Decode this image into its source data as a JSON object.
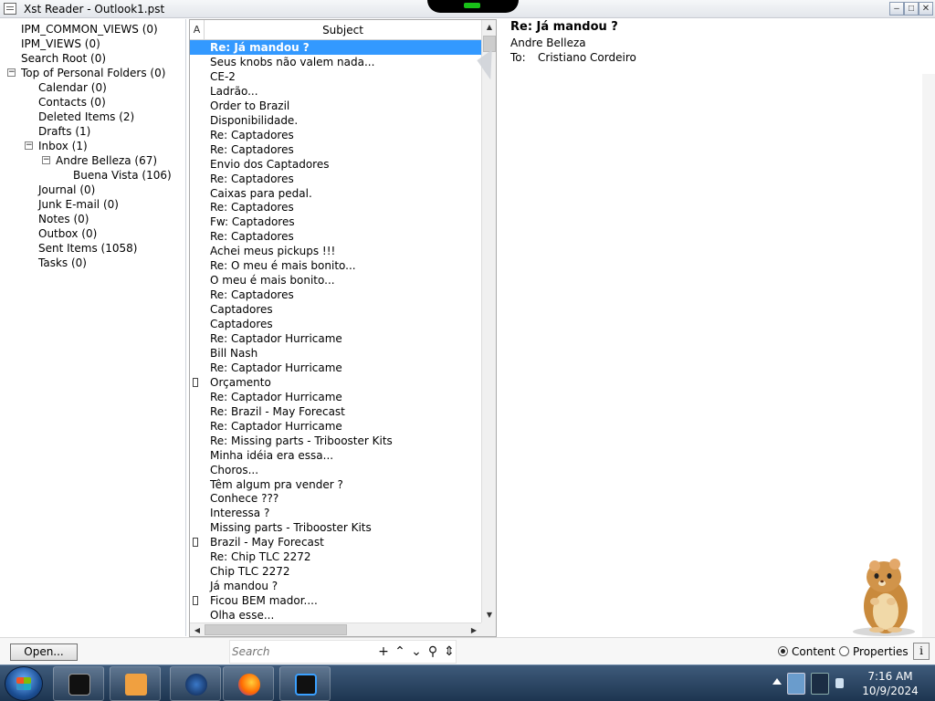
{
  "window": {
    "title": "Xst Reader - Outlook1.pst",
    "min_symbol": "–",
    "max_symbol": "□",
    "close_symbol": "✕"
  },
  "folders": [
    {
      "label": "IPM_COMMON_VIEWS (0)",
      "depth": 0,
      "expander": ""
    },
    {
      "label": "IPM_VIEWS (0)",
      "depth": 0,
      "expander": ""
    },
    {
      "label": "Search Root (0)",
      "depth": 0,
      "expander": ""
    },
    {
      "label": "Top of Personal Folders (0)",
      "depth": 0,
      "expander": "−"
    },
    {
      "label": "Calendar (0)",
      "depth": 1,
      "expander": ""
    },
    {
      "label": "Contacts (0)",
      "depth": 1,
      "expander": ""
    },
    {
      "label": "Deleted Items (2)",
      "depth": 1,
      "expander": ""
    },
    {
      "label": "Drafts (1)",
      "depth": 1,
      "expander": ""
    },
    {
      "label": "Inbox (1)",
      "depth": 1,
      "expander": "−"
    },
    {
      "label": "Andre Belleza (67)",
      "depth": 2,
      "expander": "−"
    },
    {
      "label": "Buena Vista (106)",
      "depth": 3,
      "expander": ""
    },
    {
      "label": "Journal (0)",
      "depth": 1,
      "expander": ""
    },
    {
      "label": "Junk E-mail (0)",
      "depth": 1,
      "expander": ""
    },
    {
      "label": "Notes (0)",
      "depth": 1,
      "expander": ""
    },
    {
      "label": "Outbox (0)",
      "depth": 1,
      "expander": ""
    },
    {
      "label": "Sent Items (1058)",
      "depth": 1,
      "expander": ""
    },
    {
      "label": "Tasks (0)",
      "depth": 1,
      "expander": ""
    }
  ],
  "list": {
    "attach_header": "A",
    "subject_header": "Subject",
    "up_arrow": "▲",
    "down_arrow": "▼",
    "left_arrow": "◀",
    "right_arrow": "▶"
  },
  "messages": [
    {
      "subject": "Re: Já mandou ?",
      "selected": true,
      "attachment": false
    },
    {
      "subject": "Seus knobs não valem nada...",
      "selected": false,
      "attachment": false
    },
    {
      "subject": "CE-2",
      "selected": false,
      "attachment": false
    },
    {
      "subject": "Ladrão...",
      "selected": false,
      "attachment": false
    },
    {
      "subject": "Order to Brazil",
      "selected": false,
      "attachment": false
    },
    {
      "subject": "Disponibilidade.",
      "selected": false,
      "attachment": false
    },
    {
      "subject": "Re: Captadores",
      "selected": false,
      "attachment": false
    },
    {
      "subject": "Re: Captadores",
      "selected": false,
      "attachment": false
    },
    {
      "subject": "Envio dos Captadores",
      "selected": false,
      "attachment": false
    },
    {
      "subject": "Re: Captadores",
      "selected": false,
      "attachment": false
    },
    {
      "subject": "Caixas para pedal.",
      "selected": false,
      "attachment": false
    },
    {
      "subject": "Re: Captadores",
      "selected": false,
      "attachment": false
    },
    {
      "subject": "Fw: Captadores",
      "selected": false,
      "attachment": false
    },
    {
      "subject": "Re: Captadores",
      "selected": false,
      "attachment": false
    },
    {
      "subject": "Achei meus pickups !!!",
      "selected": false,
      "attachment": false
    },
    {
      "subject": "Re: O meu é mais bonito...",
      "selected": false,
      "attachment": false
    },
    {
      "subject": "O meu é mais bonito...",
      "selected": false,
      "attachment": false
    },
    {
      "subject": "Re: Captadores",
      "selected": false,
      "attachment": false
    },
    {
      "subject": "Captadores",
      "selected": false,
      "attachment": false
    },
    {
      "subject": "Captadores",
      "selected": false,
      "attachment": false
    },
    {
      "subject": "Re: Captador Hurricame",
      "selected": false,
      "attachment": false
    },
    {
      "subject": "Bill Nash",
      "selected": false,
      "attachment": false
    },
    {
      "subject": "Re: Captador Hurricame",
      "selected": false,
      "attachment": false
    },
    {
      "subject": "Orçamento",
      "selected": false,
      "attachment": true
    },
    {
      "subject": "Re: Captador Hurricame",
      "selected": false,
      "attachment": false
    },
    {
      "subject": "Re: Brazil - May Forecast",
      "selected": false,
      "attachment": false
    },
    {
      "subject": "Re: Captador Hurricame",
      "selected": false,
      "attachment": false
    },
    {
      "subject": "Re: Missing parts - Tribooster Kits",
      "selected": false,
      "attachment": false
    },
    {
      "subject": "Minha idéia era essa...",
      "selected": false,
      "attachment": false
    },
    {
      "subject": "Choros...",
      "selected": false,
      "attachment": false
    },
    {
      "subject": "Têm algum pra vender ?",
      "selected": false,
      "attachment": false
    },
    {
      "subject": "Conhece ???",
      "selected": false,
      "attachment": false
    },
    {
      "subject": "Interessa ?",
      "selected": false,
      "attachment": false
    },
    {
      "subject": "Missing parts - Tribooster Kits",
      "selected": false,
      "attachment": false
    },
    {
      "subject": "Brazil - May Forecast",
      "selected": false,
      "attachment": true
    },
    {
      "subject": "Re: Chip TLC 2272",
      "selected": false,
      "attachment": false
    },
    {
      "subject": "Chip TLC 2272",
      "selected": false,
      "attachment": false
    },
    {
      "subject": "Já mandou ?",
      "selected": false,
      "attachment": false
    },
    {
      "subject": "Ficou BEM mador....",
      "selected": false,
      "attachment": true
    },
    {
      "subject": "Olha esse...",
      "selected": false,
      "attachment": false
    }
  ],
  "content": {
    "subject": "Re: Já mandou ?",
    "from": "Andre Belleza",
    "to_label": "To:",
    "to_value": "Cristiano Cordeiro"
  },
  "bottom": {
    "open_label": "Open...",
    "search_placeholder": "Search",
    "add_symbol": "+",
    "up_symbol": "⌃",
    "down_symbol": "⌄",
    "search_symbol": "⚲",
    "updown_symbol": "⇕",
    "radio_content": "Content",
    "radio_properties": "Properties",
    "view_mode": "Content",
    "info_label": "i"
  },
  "taskbar": {
    "time": "7:16 AM",
    "date": "10/9/2024"
  },
  "colors": {
    "selection": "#3399ff",
    "taskbar": "#1d3550"
  },
  "icons": {
    "app": "app-window-icon",
    "start": "windows-start-orb",
    "mascot": "hamster-mascot"
  }
}
